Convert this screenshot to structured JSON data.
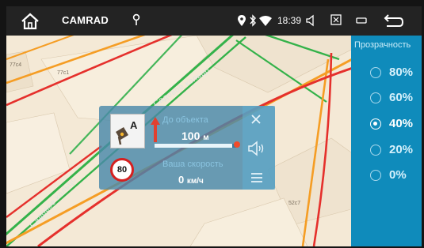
{
  "status_bar": {
    "app_name": "CAMRAD",
    "time": "18:39",
    "icons": [
      "home-icon",
      "location-pin-icon",
      "location-icon",
      "bluetooth-icon",
      "wifi-icon",
      "volume-icon",
      "window-icon",
      "minimize-icon",
      "back-icon"
    ]
  },
  "map": {
    "labels": [
      "77c4",
      "77c1",
      "52c7"
    ],
    "streets": [
      "Садовое кольцо",
      "Садовое кольцо"
    ]
  },
  "widget": {
    "distance_label": "До объекта",
    "distance_value": "100",
    "distance_unit": "м",
    "speed_label": "Ваша скорость",
    "speed_value": "0",
    "speed_unit": "км/ч",
    "speed_limit": "80",
    "progress": 0.95
  },
  "transparency": {
    "title": "Прозрачность",
    "options": [
      "80%",
      "60%",
      "40%",
      "20%",
      "0%"
    ],
    "selected": "40%"
  },
  "colors": {
    "panel": "#0f8bbb",
    "widget": "#4989aa",
    "map_bg": "#f4e9d6",
    "road_red": "#e5302c",
    "road_orange": "#f59d24",
    "road_green": "#34b24a"
  }
}
